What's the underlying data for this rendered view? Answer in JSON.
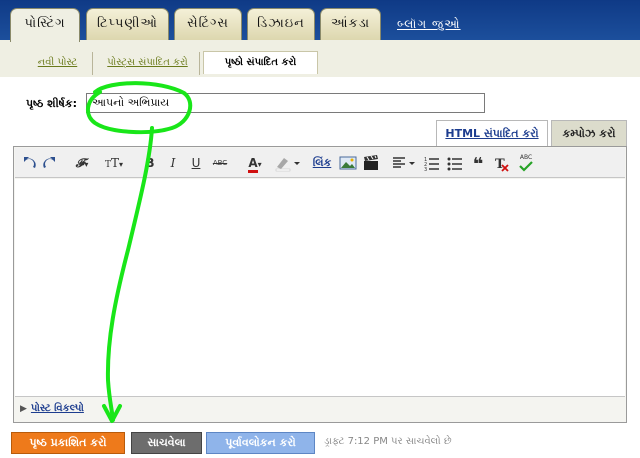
{
  "top_tabs": [
    {
      "label": "પોસ્ટિંગ",
      "active": true
    },
    {
      "label": "ટિપ્પણીઓ",
      "active": false
    },
    {
      "label": "સેટિંગ્સ",
      "active": false
    },
    {
      "label": "ડિઝાઇન",
      "active": false
    },
    {
      "label": "આંકડા",
      "active": false
    }
  ],
  "view_blog_link": "બ્લૉગ જુઓ",
  "sub_tabs": [
    {
      "label": "નવી પોસ્ટ",
      "active": false
    },
    {
      "label": "પોસ્ટ્સ સંપાદિત કરો",
      "active": false
    },
    {
      "label": "પૃષ્ઠો સંપાદિત કરો",
      "active": true
    }
  ],
  "page_title": {
    "label": "પૃષ્ઠ શીર્ષક:",
    "value": "આપનો અભિપ્રાય"
  },
  "mode_tabs": {
    "html": "HTML સંપાદિત કરો",
    "compose": "કમ્પોઝ કરો"
  },
  "toolbar": {
    "link_label": "લિંક",
    "spellcheck_label": "ABC"
  },
  "post_options": "પોસ્ટ વિકલ્પો",
  "buttons": {
    "publish": "પૃષ્ઠ પ્રકાશિત કરો",
    "save": "સાચવેલા",
    "preview": "પૂર્વાવલોકન કરો"
  },
  "status_text": "ડ્રાફ્ટ 7:12 PM પર સાચવેલો છે",
  "colors": {
    "header_blue": "#173f8a",
    "tab_beige": "#e8e4c4",
    "publish_orange": "#ee7a1b",
    "save_gray": "#6d6d6d",
    "preview_blue": "#8fb4ea",
    "annotation_green": "#19e619"
  }
}
